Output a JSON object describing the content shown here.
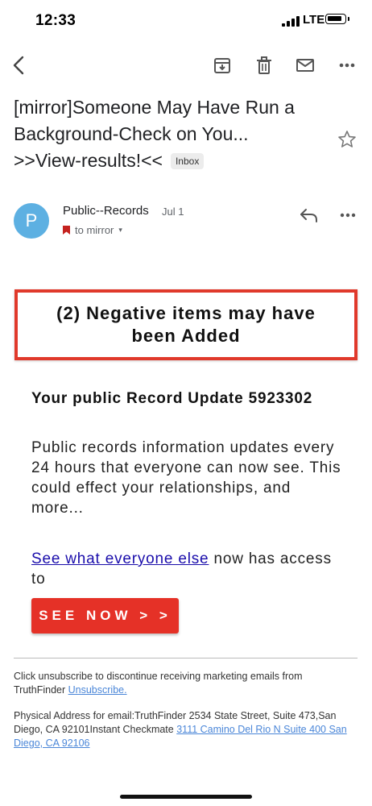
{
  "status": {
    "time": "12:33",
    "network": "LTE"
  },
  "toolbar": {
    "back": "back-arrow-icon",
    "archive": "archive-icon",
    "delete": "trash-icon",
    "mark_unread": "mail-icon",
    "more": "more-horizontal-icon"
  },
  "email": {
    "subject_line1": "[mirror]Someone May Have Run a",
    "subject_line2": "Background-Check on You...",
    "subject_line3": ">>View-results!<<",
    "label": "Inbox",
    "sender_initial": "P",
    "sender": "Public--Records",
    "date": "Jul 1",
    "recipient": "to mirror"
  },
  "body": {
    "alert_text": "(2) Negative items may have been Added",
    "record_title": "Your public Record Update 5923302",
    "record_text": "Public records information updates every 24 hours that everyone can now see. This could effect your relationships, and more...",
    "access_link": "See what everyone else",
    "access_text": " now has access to",
    "cta_label": "SEE NOW > >"
  },
  "footer": {
    "unsubscribe_text": "Click unsubscribe to discontinue receiving marketing emails from TruthFinder ",
    "unsubscribe_link": "Unsubscribe.",
    "address_text": "Physical Address for email:TruthFinder 2534 State Street, Suite 473,San Diego, CA 92101Instant Checkmate ",
    "address_link": "3111 Camino Del Rio N Suite 400 San Diego, CA 92106"
  },
  "colors": {
    "alert_border": "#e0392b",
    "cta_background": "#e53127",
    "avatar": "#5db0e2",
    "link": "#1a0dab",
    "footer_link": "#4a86d8"
  }
}
